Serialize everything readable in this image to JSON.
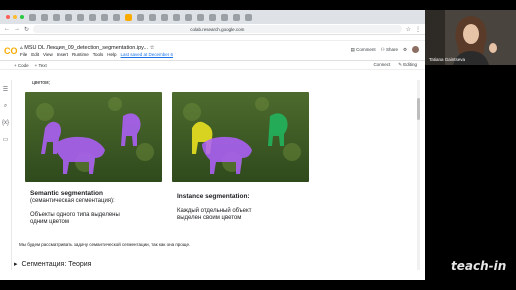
{
  "browser": {
    "url": "colab.research.google.com"
  },
  "notebook": {
    "title": "MSU DL Лекция_09_detection_segmentation.ipy...",
    "menus": [
      "File",
      "Edit",
      "View",
      "Insert",
      "Runtime",
      "Tools",
      "Help"
    ],
    "last_saved": "Last saved at December 6",
    "comment_label": "Comment",
    "share_label": "Share",
    "code_label": "+ Code",
    "text_label": "+ Text",
    "connect_label": "Connect",
    "editing_label": "Editing"
  },
  "content": {
    "top_text": "цветом;",
    "semantic_title": "Semantic segmentation",
    "semantic_sub": "(семантическая сегментация):",
    "semantic_desc1": "Объекты одного типа выделены",
    "semantic_desc2": "одним цветом",
    "instance_title": "Instance segmentation:",
    "instance_desc1": "Каждый отдельный объект",
    "instance_desc2": "выделен своим цветом",
    "bottom_note": "Мы будем рассматривать задачу семантической сегментации, так как она проще.",
    "section_title": "Сегментация: Теория"
  },
  "webcam": {
    "name": "Tatiana Gaintseva"
  },
  "watermark": "teach-in",
  "colors": {
    "colab_orange": "#f9ab00",
    "semantic_mask": "#b060ff",
    "instance_yellow": "#e8e020",
    "instance_green": "#20b860",
    "instance_purple": "#b060ff"
  }
}
